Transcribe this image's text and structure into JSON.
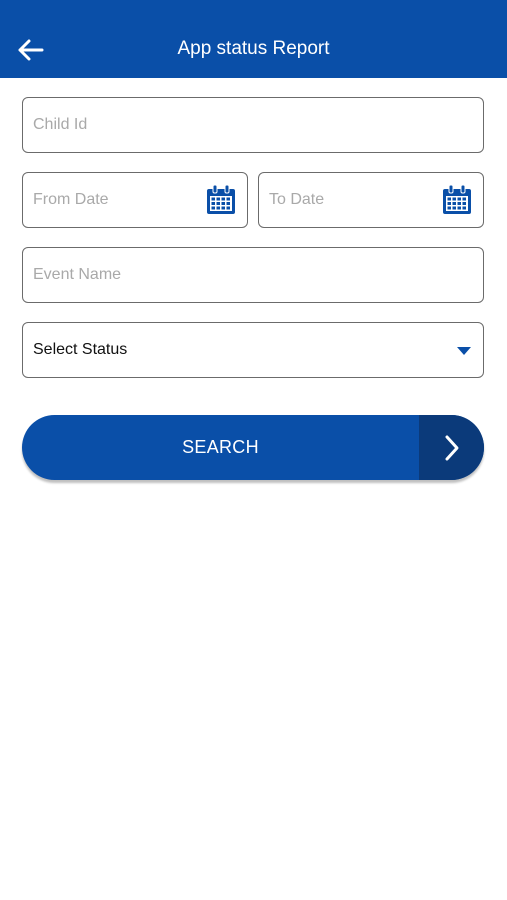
{
  "header": {
    "title": "App status Report",
    "back_icon": "arrow-left-icon"
  },
  "form": {
    "child_id": {
      "placeholder": "Child Id",
      "value": ""
    },
    "from_date": {
      "placeholder": "From Date",
      "value": "",
      "icon": "calendar-icon"
    },
    "to_date": {
      "placeholder": "To Date",
      "value": "",
      "icon": "calendar-icon"
    },
    "event_name": {
      "placeholder": "Event Name",
      "value": ""
    },
    "status": {
      "selected": "Select Status",
      "icon": "caret-down-icon"
    }
  },
  "search": {
    "label": "SEARCH",
    "icon": "chevron-right-icon"
  },
  "colors": {
    "primary": "#0a4fa8",
    "primary_dark": "#0b3a7a",
    "border": "#6b6b6b",
    "placeholder": "#a9a9a9"
  }
}
